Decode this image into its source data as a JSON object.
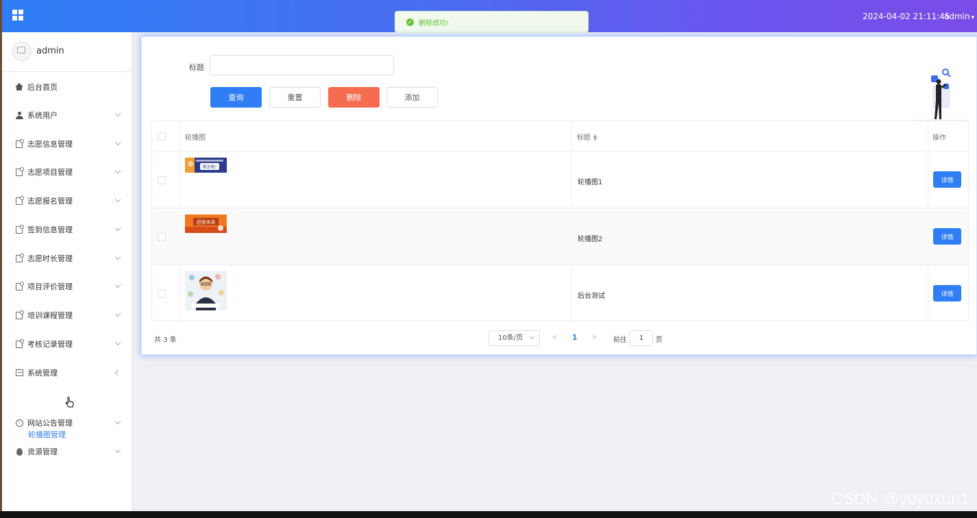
{
  "topbar": {
    "datetime": "2024-04-02 21:11:45",
    "user": "admin"
  },
  "toast": {
    "message": "删除成功!"
  },
  "sidebar": {
    "profile_name": "admin",
    "items": [
      {
        "label": "后台首页",
        "icon": "home-icon"
      },
      {
        "label": "系统用户",
        "icon": "user-icon"
      },
      {
        "label": "志愿信息管理",
        "icon": "page-icon"
      },
      {
        "label": "志愿项目管理",
        "icon": "page-icon"
      },
      {
        "label": "志愿报名管理",
        "icon": "page-icon"
      },
      {
        "label": "签到信息管理",
        "icon": "page-icon"
      },
      {
        "label": "志愿时长管理",
        "icon": "page-icon"
      },
      {
        "label": "项目评价管理",
        "icon": "page-icon"
      },
      {
        "label": "培训课程管理",
        "icon": "page-icon"
      },
      {
        "label": "考核记录管理",
        "icon": "page-icon"
      },
      {
        "label": "系统管理",
        "icon": "picture-icon"
      },
      {
        "label": "网站公告管理",
        "icon": "info-icon"
      },
      {
        "label": "资源管理",
        "icon": "pin-icon"
      }
    ],
    "active_sub_item": "轮播图管理"
  },
  "search": {
    "label": "标题",
    "value": "",
    "buttons": {
      "query": "查询",
      "reset": "重置",
      "delete": "删除",
      "add": "添加"
    }
  },
  "table": {
    "columns": {
      "image": "轮播图",
      "title": "标题",
      "action": "操作"
    },
    "rows": [
      {
        "title": "轮播图1",
        "action": "详情",
        "thumb_text": "就业啦!"
      },
      {
        "title": "轮播图2",
        "action": "详情",
        "thumb_text": "迎接未来"
      },
      {
        "title": "后台测试",
        "action": "详情"
      }
    ]
  },
  "pagination": {
    "total": "共 3 条",
    "page_size": "10条/页",
    "current_page": "1",
    "goto_label": "前往",
    "goto_value": "1",
    "goto_suffix": "页"
  },
  "watermark": "CSDN @yuyuxun1",
  "colors": {
    "primary": "#2f7ef5",
    "danger": "#f56c50",
    "success": "#67c23a",
    "topbar_start": "#2f7ef5",
    "topbar_end": "#7b4ce8"
  }
}
